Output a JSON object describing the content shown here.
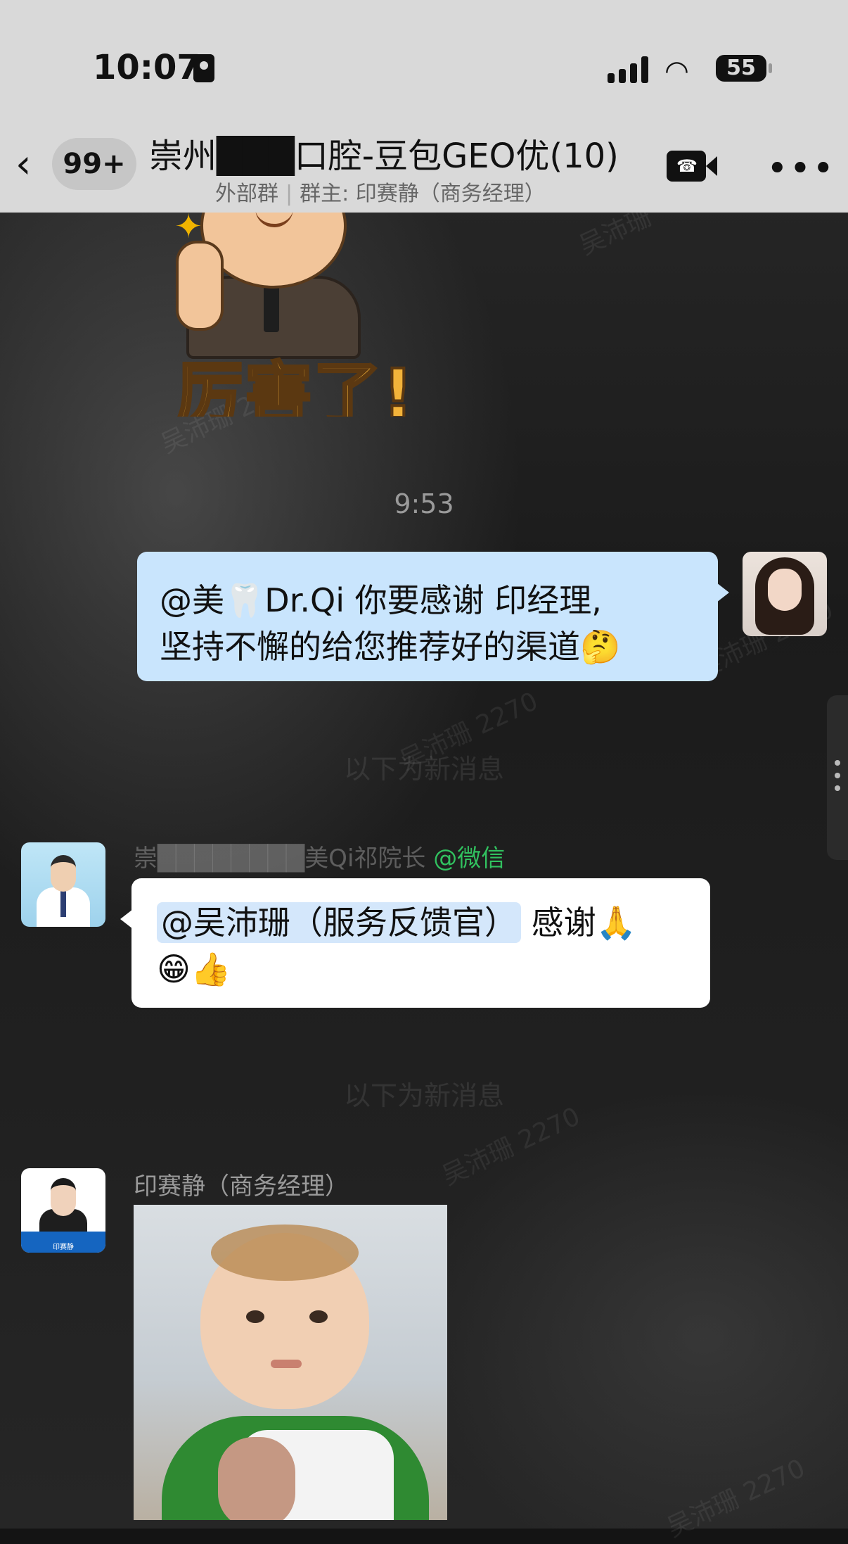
{
  "status_bar": {
    "time": "10:07",
    "battery": "55"
  },
  "header": {
    "back_icon": "chevron-left-icon",
    "unread_badge": "99+",
    "title": "崇州███口腔-豆包GEO优(10)",
    "subtitle_tag": "外部群",
    "subtitle_owner": "群主: 印赛静（商务经理）"
  },
  "messages": {
    "timestamp": "9:53",
    "me_line1": "@美🦷Dr.Qi 你要感谢  印经理,",
    "me_line2": "坚持不懈的给您推荐好的渠道🤔",
    "divider_1": "以下为新消息",
    "doctor_sender_prefix": "崇",
    "doctor_sender_redacted": "████████",
    "doctor_sender_name": "美Qi祁院长",
    "doctor_sender_wechat": "@微信",
    "doctor_mention": "@吴沛珊（服务反馈官）",
    "doctor_text_line1": "感谢🙏",
    "doctor_text_line2": "😁👍",
    "divider_2": "以下为新消息",
    "manager_sender": "印赛静（商务经理）",
    "manager_avatar_banner": "印赛静"
  },
  "sticker_caption": "厉害了!",
  "watermarks": [
    "吴沛珊",
    "吴沛珊 2270",
    "吴沛珊 2270",
    "吴沛珊 2270",
    "吴沛珊 2270",
    "吴沛珊 2270"
  ]
}
